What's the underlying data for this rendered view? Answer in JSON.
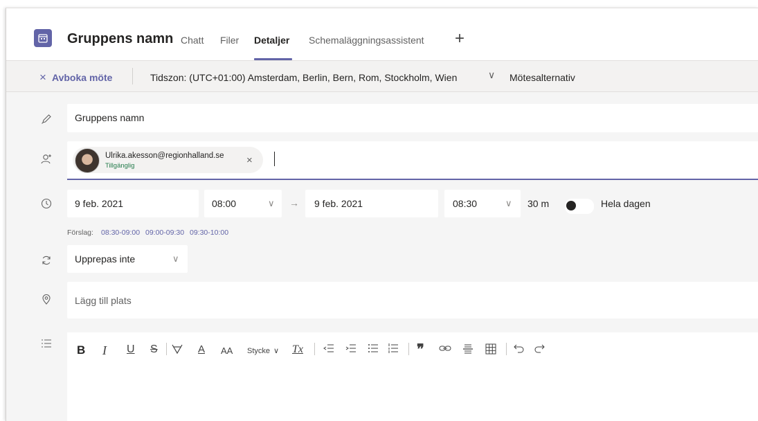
{
  "header": {
    "title": "Gruppens namn",
    "tabs": [
      {
        "label": "Chatt"
      },
      {
        "label": "Filer"
      },
      {
        "label": "Detaljer"
      },
      {
        "label": "Schemaläggningsassistent"
      }
    ],
    "add_tab": "+"
  },
  "commandbar": {
    "cancel_icon": "×",
    "cancel_label": "Avboka möte",
    "timezone": "Tidszon: (UTC+01:00) Amsterdam, Berlin, Bern, Rom, Stockholm, Wien",
    "timezone_chevron": "∨",
    "options_label": "Mötesalternativ"
  },
  "form": {
    "title_value": "Gruppens namn",
    "attendee": {
      "email": "Ulrika.akesson@regionhalland.se",
      "status": "Tillgänglig",
      "remove": "×"
    },
    "start_date": "9 feb. 2021",
    "start_time": "08:00",
    "arrow": "→",
    "end_date": "9 feb. 2021",
    "end_time": "08:30",
    "duration": "30 m",
    "all_day_label": "Hela dagen",
    "all_day_on": false,
    "suggestions_label": "Förslag:",
    "suggestions": [
      "08:30-09:00",
      "09:00-09:30",
      "09:30-10:00"
    ],
    "repeat_value": "Upprepas inte",
    "location_placeholder": "Lägg till plats"
  },
  "editor_toolbar": {
    "bold": "B",
    "italic": "I",
    "underline": "U",
    "strikethrough": "S",
    "font_size": "AA",
    "font_color": "A",
    "paragraph": "Stycke",
    "paragraph_chevron": "∨",
    "clear_format": "Tx",
    "quote": "❞"
  },
  "colors": {
    "accent": "#6264a7",
    "available": "#237b4b",
    "background": "#f5f5f5"
  }
}
